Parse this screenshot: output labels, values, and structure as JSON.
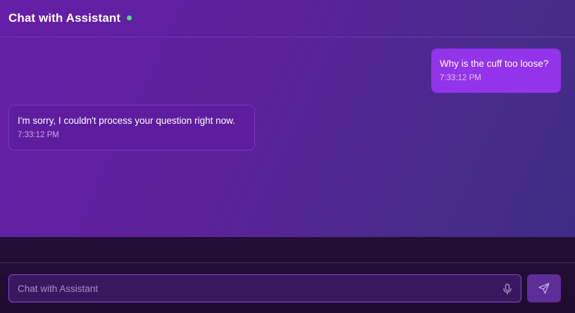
{
  "header": {
    "title": "Chat with Assistant",
    "status_color": "#4ade80"
  },
  "messages": [
    {
      "role": "user",
      "text": "Why is the cuff too loose?",
      "time": "7:33:12 PM",
      "bubble_color": "#9333ea"
    },
    {
      "role": "assistant",
      "text": "I'm sorry, I couldn't process your question right now.",
      "time": "7:33:12 PM",
      "bubble_color": "#5e1d9e"
    }
  ],
  "composer": {
    "placeholder": "Chat with Assistant",
    "value": "",
    "mic_icon": "mic-icon",
    "send_icon": "send-icon"
  },
  "colors": {
    "accent": "#9333ea",
    "input_border": "#8b47d6"
  }
}
